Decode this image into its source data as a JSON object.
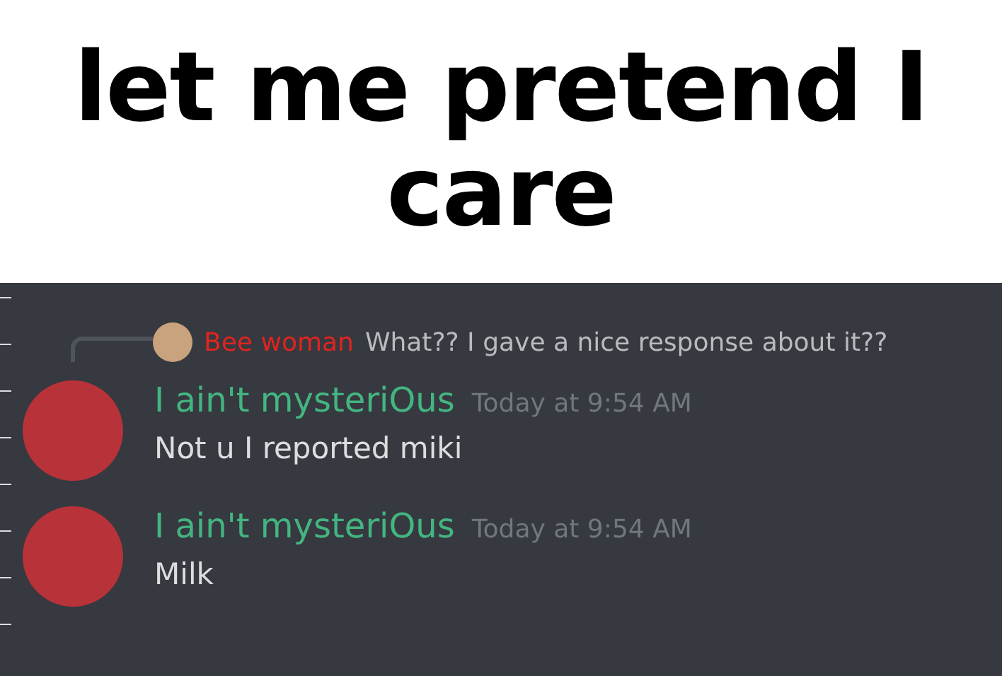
{
  "caption": "let me pretend I care",
  "reply": {
    "author": "Bee woman",
    "color": "#e0241f",
    "text": "What?? I gave a nice response about it??"
  },
  "messages": [
    {
      "author": "I ain't mysteriOus",
      "color": "#43b581",
      "time": "Today at 9:54 AM",
      "text": "Not u I reported miki"
    },
    {
      "author": "I ain't mysteriOus",
      "color": "#43b581",
      "time": "Today at 9:54 AM",
      "text": "Milk"
    }
  ]
}
